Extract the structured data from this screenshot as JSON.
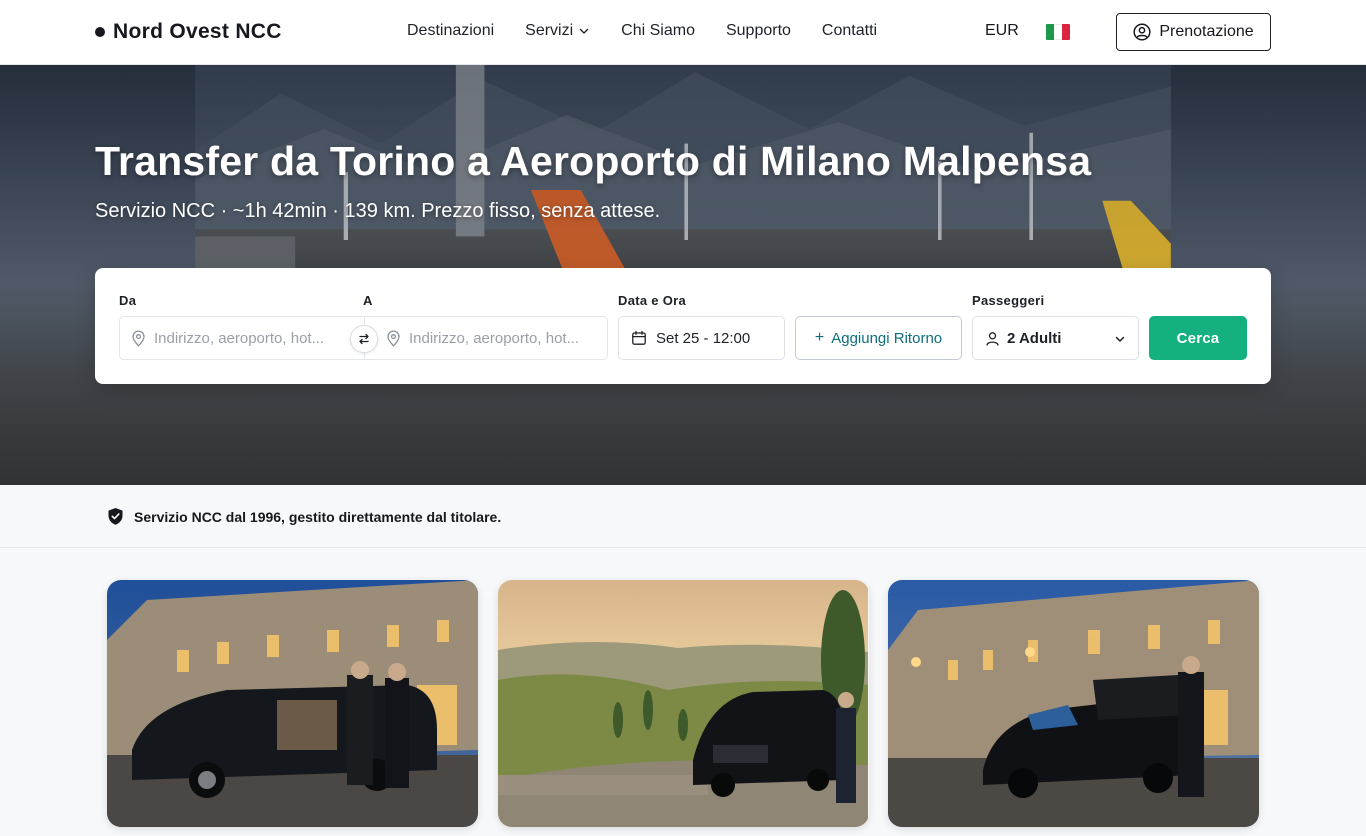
{
  "header": {
    "brand": "Nord Ovest NCC",
    "nav": [
      {
        "label": "Destinazioni",
        "has_dropdown": false
      },
      {
        "label": "Servizi",
        "has_dropdown": true
      },
      {
        "label": "Chi Siamo",
        "has_dropdown": false
      },
      {
        "label": "Supporto",
        "has_dropdown": false
      },
      {
        "label": "Contatti",
        "has_dropdown": false
      }
    ],
    "currency": "EUR",
    "language_flag": "italy-flag-icon",
    "booking_button": "Prenotazione"
  },
  "hero": {
    "title": "Transfer da Torino a Aeroporto di Milano Malpensa",
    "subtitle": "Servizio NCC · ~1h 42min · 139 km. Prezzo fisso, senza attese."
  },
  "search": {
    "from_label": "Da",
    "to_label": "A",
    "from_placeholder": "Indirizzo, aeroporto, hot...",
    "to_placeholder": "Indirizzo, aeroporto, hot...",
    "date_label": "Data e Ora",
    "date_value": "Set 25 - 12:00",
    "return_button": "Aggiungi Ritorno",
    "passengers_label": "Passeggeri",
    "passengers_value": "2 Adulti",
    "search_button": "Cerca"
  },
  "trust": {
    "text": "Servizio NCC dal 1996, gestito direttamente dal titolare."
  },
  "gallery": [
    {
      "subject": "black van at night in city square with chauffeur"
    },
    {
      "subject": "black van on countryside road at sunset"
    },
    {
      "subject": "black sedan at night in city street with chauffeur"
    }
  ],
  "colors": {
    "accent_green": "#14b07f",
    "accent_teal": "#0d6f7a",
    "text_dark": "#16181d"
  }
}
